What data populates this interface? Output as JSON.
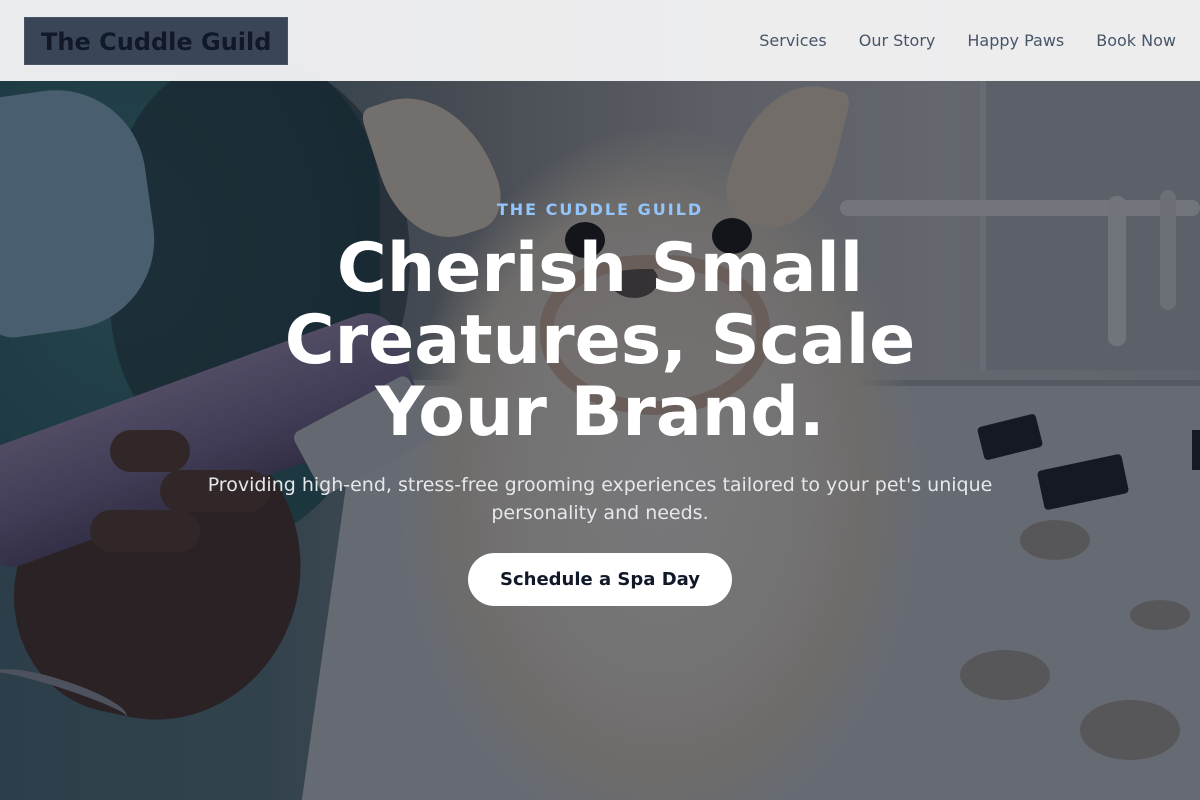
{
  "header": {
    "logo_text": "The Cuddle Guild",
    "nav": [
      {
        "label": "Services"
      },
      {
        "label": "Our Story"
      },
      {
        "label": "Happy Paws"
      },
      {
        "label": "Book Now"
      }
    ]
  },
  "hero": {
    "eyebrow": "THE CUDDLE GUILD",
    "headline": "Cherish Small Creatures, Scale Your Brand.",
    "subtext": "Providing high-end, stress-free grooming experiences tailored to your pet's unique personality and needs.",
    "cta_label": "Schedule a Spa Day"
  },
  "colors": {
    "accent_eyebrow": "#93c5fd",
    "logo_bg": "#3a4658",
    "overlay": "#111827",
    "cta_bg": "#ffffff"
  }
}
